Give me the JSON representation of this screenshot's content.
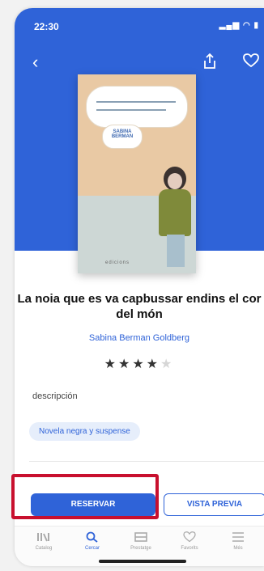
{
  "status": {
    "time": "22:30"
  },
  "book": {
    "title": "La noia que es va capbussar endins el cor del món",
    "author": "Sabina Berman Goldberg",
    "cover_author": "SABINA BERMAN",
    "publisher_mark": "edicions",
    "rating": 4,
    "rating_max": 5,
    "description_label": "descripción",
    "genre": "Novela negra y suspense"
  },
  "actions": {
    "reserve": "RESERVAR",
    "preview": "VISTA PREVIA"
  },
  "tabs": [
    {
      "label": "Catalog",
      "icon": "catalog-icon"
    },
    {
      "label": "Cercar",
      "icon": "search-icon"
    },
    {
      "label": "Prestatge",
      "icon": "shelf-icon"
    },
    {
      "label": "Favorits",
      "icon": "heart-icon"
    },
    {
      "label": "Més",
      "icon": "menu-icon"
    }
  ],
  "colors": {
    "accent": "#2f63d8",
    "highlight": "#c8102e"
  }
}
